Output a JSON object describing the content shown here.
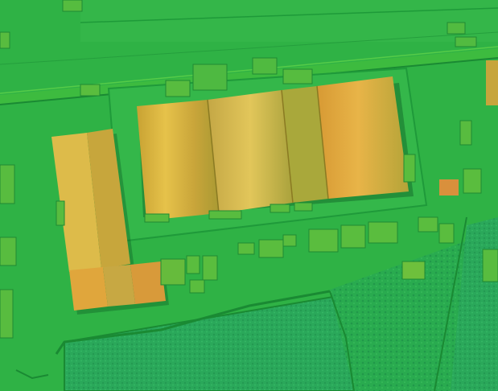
{
  "map": {
    "kind": "digital-surface-model-hillshade",
    "palette": {
      "ground": "#2fb245",
      "ground_dark": "#1e9a39",
      "field": "#2aa85a",
      "road": "#45c23e",
      "roof_yellow": "#d9b53a",
      "roof_olive": "#a7a83a",
      "roof_orange": "#d9963a",
      "shadow": "#0f5f25",
      "small_building": "#5cb93b"
    },
    "features": [
      {
        "id": "warehouse-large",
        "kind": "building"
      },
      {
        "id": "warehouse-west",
        "kind": "building"
      },
      {
        "id": "annex-south",
        "kind": "building"
      },
      {
        "id": "field-south",
        "kind": "field"
      },
      {
        "id": "field-east",
        "kind": "field"
      },
      {
        "id": "road-north",
        "kind": "road"
      }
    ]
  }
}
